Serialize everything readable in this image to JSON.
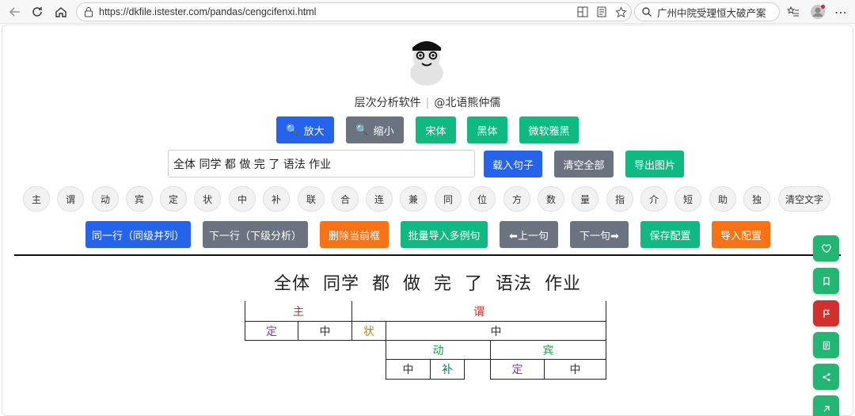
{
  "browser": {
    "url": "https://dkfile.istester.com/pandas/cengcifenxi.html",
    "search_text": "广州中院受理恒大破产案"
  },
  "app": {
    "title": "层次分析软件",
    "author": "@北语熊仲儒"
  },
  "toolbar1": {
    "zoom_in": "放大",
    "zoom_out": "缩小",
    "font_song": "宋体",
    "font_hei": "黑体",
    "font_yahei": "微软雅黑"
  },
  "input_row": {
    "sentence_value": "全体 同学 都 做 完 了 语法 作业",
    "load": "载入句子",
    "clear_all": "清空全部",
    "export_image": "导出图片"
  },
  "labels": [
    "主",
    "谓",
    "动",
    "宾",
    "定",
    "状",
    "中",
    "补",
    "联",
    "合",
    "连",
    "兼",
    "同",
    "位",
    "方",
    "数",
    "量",
    "指",
    "介",
    "短",
    "助",
    "独",
    "清空文字"
  ],
  "toolbar2": {
    "same_row": "同一行（同级并列）",
    "next_row": "下一行（下级分析）",
    "delete_box": "删除当前框",
    "batch_import": "批量导入多例句",
    "prev": "⬅上一句",
    "next": "下一句➡",
    "save_config": "保存配置",
    "import_config": "导入配置"
  },
  "analysis": {
    "sentence_words": [
      "全体",
      "同学",
      "都",
      "做",
      "完",
      "了",
      "语法",
      "作业"
    ],
    "cells": {
      "zhu": "主",
      "wei": "谓",
      "ding1": "定",
      "zhong1": "中",
      "zhuang": "状",
      "zhong2": "中",
      "dong": "动",
      "bin": "宾",
      "zhong3": "中",
      "bu": "补",
      "ding2": "定",
      "zhong4": "中"
    }
  },
  "colors": {
    "zhu_wei": "#c0392b",
    "ding": "#7b3fa0",
    "zhuang": "#d97706",
    "dong_bin": "#16a34a",
    "bu": "#0f766e",
    "zhong": "#333333"
  }
}
